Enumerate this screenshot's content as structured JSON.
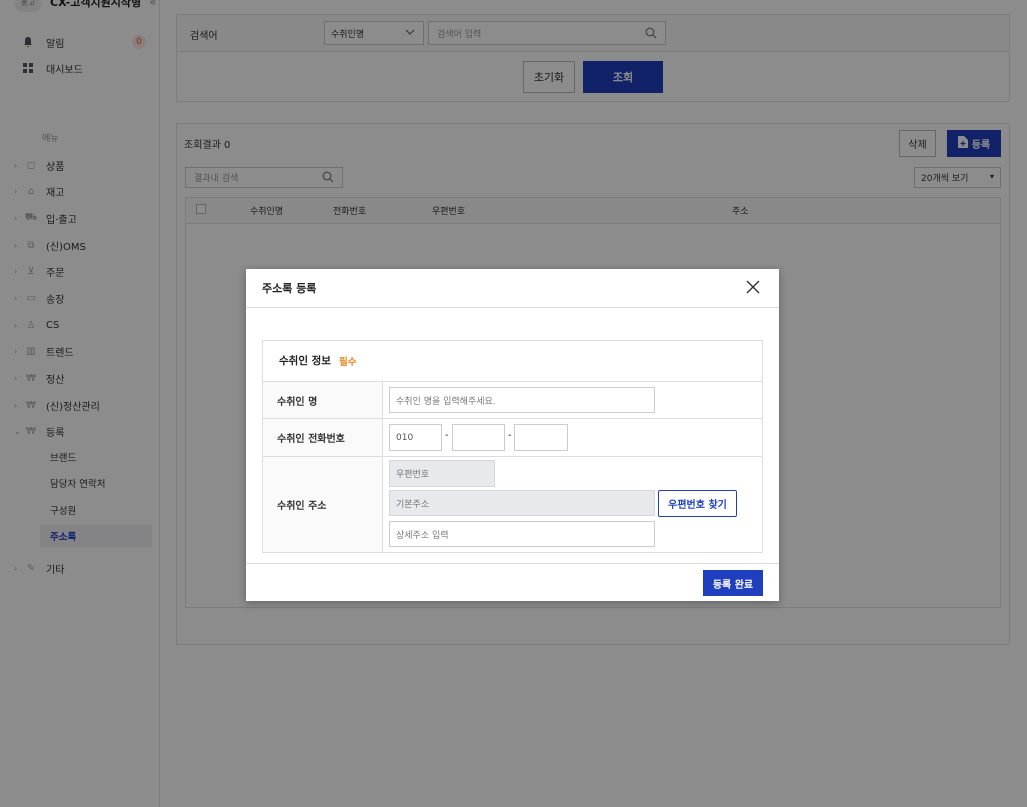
{
  "sidebar": {
    "logo_text": "홍고",
    "app_name": "CX-고객지원시작형",
    "collapse_glyph": "«",
    "top": [
      {
        "label": "알림",
        "badge": "0"
      },
      {
        "label": "대시보드"
      }
    ],
    "menu_header": "메뉴",
    "items": [
      {
        "label": "상품"
      },
      {
        "label": "재고"
      },
      {
        "label": "입·출고"
      },
      {
        "label": "(신)OMS"
      },
      {
        "label": "주문"
      },
      {
        "label": "송장"
      },
      {
        "label": "CS"
      },
      {
        "label": "트렌드"
      },
      {
        "label": "정산"
      },
      {
        "label": "(신)정산관리"
      },
      {
        "label": "등록"
      },
      {
        "label": "기타"
      }
    ],
    "sub_items": [
      {
        "label": "브랜드"
      },
      {
        "label": "담당자 연락처"
      },
      {
        "label": "구성원"
      },
      {
        "label": "주소록"
      }
    ]
  },
  "search": {
    "label": "검색어",
    "select_value": "수취인명",
    "input_placeholder": "검색어 입력",
    "reset_button": "초기화",
    "search_button": "조회"
  },
  "results": {
    "title": "조회결과 0",
    "delete_button": "삭제",
    "register_button": "등록",
    "filter_placeholder": "결과내 검색",
    "page_size": "20개씩 보기",
    "columns": [
      "수취인명",
      "전화번호",
      "우편번호",
      "주소"
    ]
  },
  "modal": {
    "title": "주소록 등록",
    "section_title": "수취인 정보",
    "required_tag": "필수",
    "fields": {
      "name_label": "수취인 명",
      "name_placeholder": "수취인 명을 입력해주세요.",
      "phone_label": "수취인 전화번호",
      "phone_first_placeholder": "010",
      "dash": "-",
      "address_label": "수취인 주소",
      "zip_placeholder": "우편번호",
      "base_addr_placeholder": "기본주소",
      "find_zip_button": "우편번호 찾기",
      "detail_addr_placeholder": "상세주소 입력"
    },
    "submit_button": "등록 완료"
  },
  "colors": {
    "accent": "#1f3fbf",
    "required": "#e8891a"
  }
}
